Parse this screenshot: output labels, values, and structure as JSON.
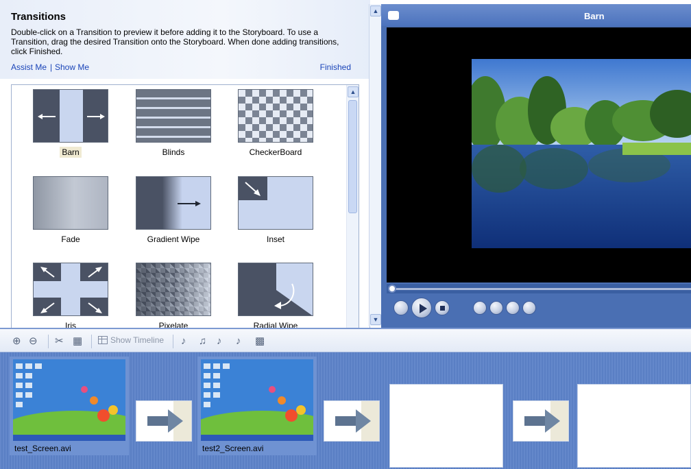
{
  "task_pane": {
    "title": "Transitions",
    "description": "Double-click on a Transition to preview it before adding it to the Storyboard. To use a Transition, drag the desired Transition onto the Storyboard.  When done adding transitions, click Finished.",
    "links": {
      "assist": "Assist Me",
      "separator": "|",
      "show": "Show Me",
      "finished": "Finished"
    }
  },
  "transitions": [
    {
      "label": "Barn",
      "selected": true
    },
    {
      "label": "Blinds"
    },
    {
      "label": "CheckerBoard"
    },
    {
      "label": "Fade"
    },
    {
      "label": "Gradient Wipe"
    },
    {
      "label": "Inset"
    },
    {
      "label": "Iris"
    },
    {
      "label": "Pixelate"
    },
    {
      "label": "Radial Wipe"
    }
  ],
  "preview": {
    "title": "Barn"
  },
  "storyboard": {
    "toolbar": {
      "show_timeline": "Show Timeline"
    },
    "clips": [
      {
        "label": "test_Screen.avi"
      },
      {
        "label": "test2_Screen.avi"
      }
    ]
  },
  "colors": {
    "link": "#1a44b8",
    "storyboard_bg": "#5a7fc4",
    "preview_bg": "#4a6fb3"
  }
}
